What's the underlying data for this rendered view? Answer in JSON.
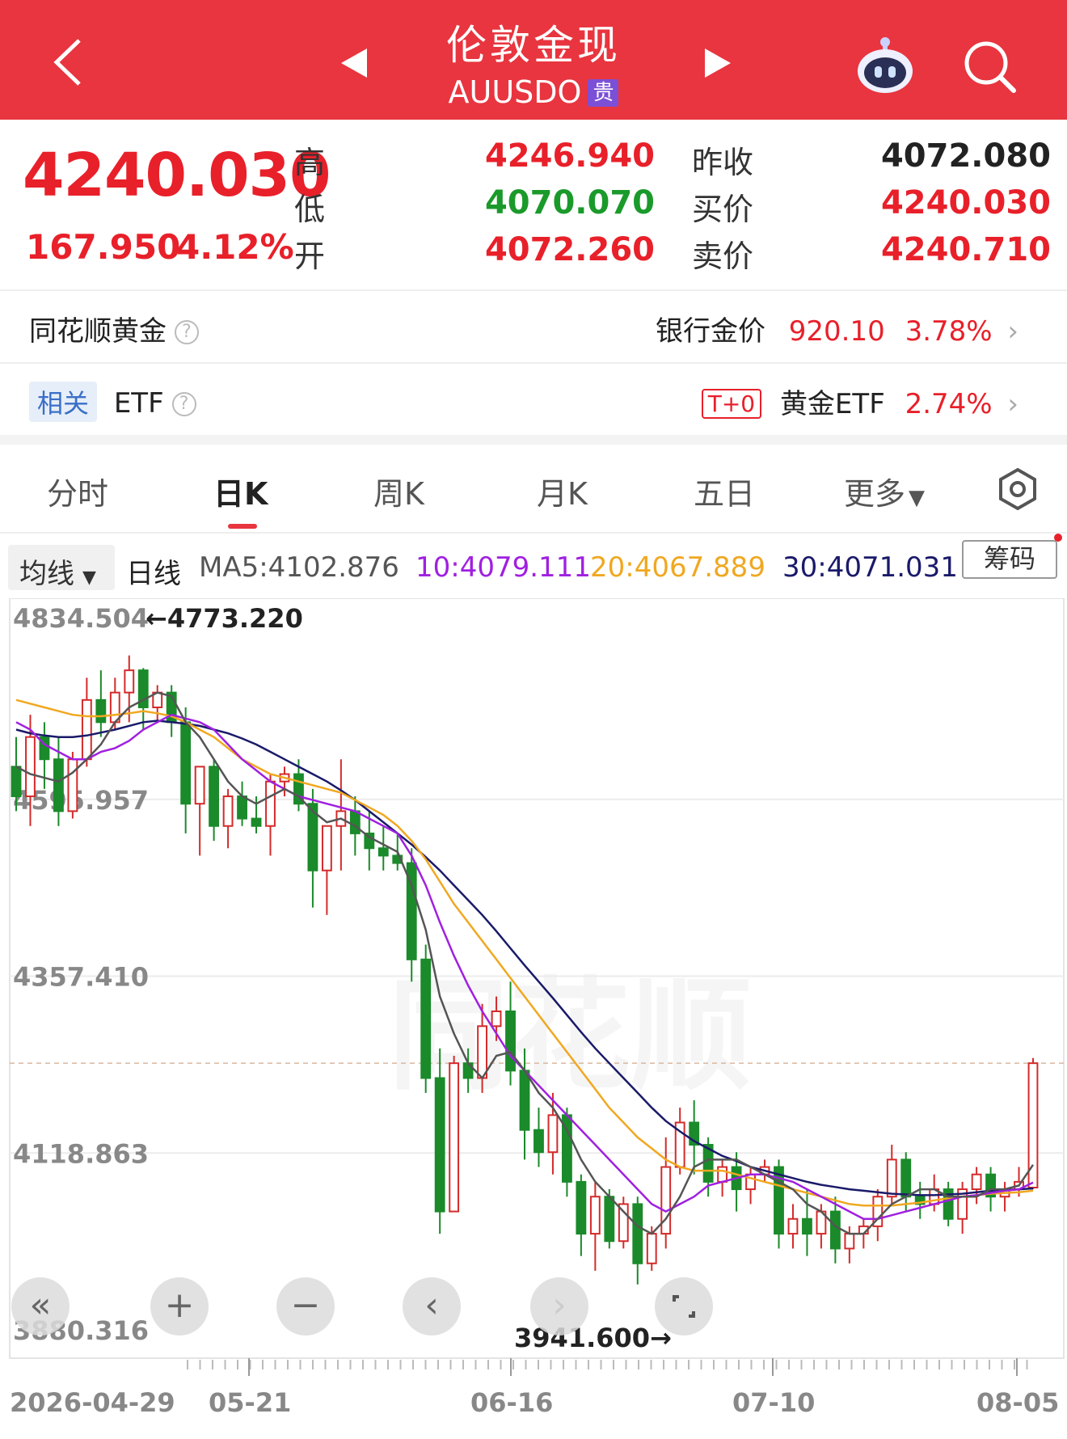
{
  "header": {
    "title": "伦敦金现",
    "code": "AUUSDO",
    "tag": "贵"
  },
  "quote": {
    "price": "4240.030",
    "change": "167.950",
    "change_pct": "4.12%",
    "high_label": "高",
    "low_label": "低",
    "open_label": "开",
    "high": "4246.940",
    "low": "4070.070",
    "open": "4072.260",
    "prev_close_label": "昨收",
    "bid_label": "买价",
    "ask_label": "卖价",
    "prev_close": "4072.080",
    "bid": "4240.030",
    "ask": "4240.710"
  },
  "ths_gold": {
    "label": "同花顺黄金",
    "bank_label": "银行金价",
    "bank_price": "920.10",
    "bank_pct": "3.78%"
  },
  "etf": {
    "tag": "相关",
    "label": "ETF",
    "t0": "T+0",
    "name": "黄金ETF",
    "pct": "2.74%"
  },
  "tabs": [
    "分时",
    "日K",
    "周K",
    "月K",
    "五日",
    "更多"
  ],
  "ma_bar": {
    "select": "均线",
    "period": "日线",
    "ma5": "MA5:4102.876",
    "ma10": "10:4079.111",
    "ma20": "20:4067.889",
    "ma30": "30:4071.031",
    "chip_button": "筹码"
  },
  "colors": {
    "up": "#d42a2a",
    "down": "#1a8a2a",
    "ma5": "#555555",
    "ma10": "#a020e0",
    "ma20": "#f0a820",
    "ma30": "#1a1a6a"
  },
  "chart_data": {
    "type": "candlestick",
    "y_ticks": [
      "4834.504",
      "4595.957",
      "4357.410",
      "4118.863",
      "3880.316"
    ],
    "ylim": [
      3880.316,
      4834.504
    ],
    "x_ticks": [
      "2026-04-29",
      "05-21",
      "06-16",
      "07-10",
      "08-05"
    ],
    "high_marker": "←4773.220",
    "low_marker": "3941.600→",
    "last_price": 4240.03,
    "candles": [
      [
        4640,
        4680,
        4580,
        4600
      ],
      [
        4600,
        4710,
        4560,
        4680
      ],
      [
        4680,
        4700,
        4610,
        4650
      ],
      [
        4650,
        4680,
        4560,
        4580
      ],
      [
        4580,
        4660,
        4570,
        4650
      ],
      [
        4650,
        4760,
        4640,
        4730
      ],
      [
        4730,
        4770,
        4680,
        4700
      ],
      [
        4700,
        4760,
        4690,
        4740
      ],
      [
        4740,
        4790,
        4700,
        4770
      ],
      [
        4770,
        4773,
        4690,
        4720
      ],
      [
        4720,
        4750,
        4700,
        4740
      ],
      [
        4740,
        4750,
        4680,
        4700
      ],
      [
        4700,
        4720,
        4550,
        4590
      ],
      [
        4590,
        4640,
        4520,
        4640
      ],
      [
        4640,
        4650,
        4540,
        4560
      ],
      [
        4560,
        4610,
        4530,
        4600
      ],
      [
        4600,
        4620,
        4560,
        4570
      ],
      [
        4570,
        4600,
        4550,
        4560
      ],
      [
        4560,
        4630,
        4520,
        4620
      ],
      [
        4620,
        4640,
        4600,
        4630
      ],
      [
        4630,
        4650,
        4580,
        4590
      ],
      [
        4590,
        4610,
        4450,
        4500
      ],
      [
        4500,
        4560,
        4440,
        4560
      ],
      [
        4560,
        4650,
        4500,
        4580
      ],
      [
        4580,
        4600,
        4520,
        4550
      ],
      [
        4550,
        4580,
        4500,
        4530
      ],
      [
        4530,
        4560,
        4500,
        4520
      ],
      [
        4520,
        4550,
        4500,
        4510
      ],
      [
        4510,
        4530,
        4350,
        4380
      ],
      [
        4380,
        4400,
        4200,
        4220
      ],
      [
        4220,
        4260,
        4010,
        4040
      ],
      [
        4040,
        4250,
        4040,
        4240
      ],
      [
        4240,
        4260,
        4200,
        4220
      ],
      [
        4220,
        4320,
        4200,
        4290
      ],
      [
        4290,
        4330,
        4270,
        4310
      ],
      [
        4310,
        4350,
        4210,
        4230
      ],
      [
        4230,
        4260,
        4110,
        4150
      ],
      [
        4150,
        4180,
        4100,
        4120
      ],
      [
        4120,
        4200,
        4090,
        4170
      ],
      [
        4170,
        4180,
        4060,
        4080
      ],
      [
        4080,
        4090,
        3980,
        4010
      ],
      [
        4010,
        4080,
        3960,
        4060
      ],
      [
        4060,
        4070,
        3990,
        4000
      ],
      [
        4000,
        4060,
        3990,
        4050
      ],
      [
        4050,
        4060,
        3941.6,
        3970
      ],
      [
        3970,
        4020,
        3960,
        4010
      ],
      [
        4010,
        4140,
        3990,
        4100
      ],
      [
        4100,
        4180,
        4090,
        4160
      ],
      [
        4160,
        4190,
        4090,
        4130
      ],
      [
        4130,
        4140,
        4060,
        4080
      ],
      [
        4080,
        4110,
        4060,
        4100
      ],
      [
        4100,
        4120,
        4040,
        4070
      ],
      [
        4070,
        4100,
        4050,
        4090
      ],
      [
        4090,
        4110,
        4080,
        4100
      ],
      [
        4100,
        4110,
        3990,
        4010
      ],
      [
        4010,
        4050,
        3990,
        4030
      ],
      [
        4030,
        4070,
        3980,
        4010
      ],
      [
        4010,
        4050,
        3990,
        4040
      ],
      [
        4040,
        4060,
        3970,
        3990
      ],
      [
        3990,
        4020,
        3970,
        4010
      ],
      [
        4010,
        4030,
        3990,
        4020
      ],
      [
        4020,
        4070,
        4000,
        4060
      ],
      [
        4060,
        4130,
        4050,
        4110
      ],
      [
        4110,
        4120,
        4040,
        4060
      ],
      [
        4060,
        4080,
        4030,
        4050
      ],
      [
        4050,
        4090,
        4040,
        4070
      ],
      [
        4070,
        4080,
        4020,
        4030
      ],
      [
        4030,
        4080,
        4010,
        4070
      ],
      [
        4070,
        4100,
        4050,
        4090
      ],
      [
        4090,
        4100,
        4040,
        4060
      ],
      [
        4060,
        4080,
        4040,
        4070
      ],
      [
        4070,
        4100,
        4060,
        4080
      ],
      [
        4072.26,
        4246.94,
        4070.07,
        4240.03
      ]
    ],
    "ma5": [
      4640,
      4630,
      4625,
      4620,
      4632,
      4650,
      4670,
      4700,
      4720,
      4730,
      4740,
      4735,
      4700,
      4680,
      4650,
      4620,
      4600,
      4590,
      4600,
      4610,
      4600,
      4580,
      4565,
      4570,
      4560,
      4545,
      4535,
      4525,
      4480,
      4420,
      4330,
      4280,
      4240,
      4220,
      4250,
      4255,
      4230,
      4200,
      4180,
      4150,
      4110,
      4080,
      4060,
      4040,
      4020,
      4010,
      4030,
      4060,
      4100,
      4110,
      4110,
      4110,
      4100,
      4090,
      4080,
      4070,
      4050,
      4040,
      4020,
      4010,
      4010,
      4030,
      4050,
      4060,
      4070,
      4070,
      4060,
      4060,
      4060,
      4070,
      4070,
      4075,
      4103
    ],
    "ma10": [
      4700,
      4690,
      4670,
      4660,
      4650,
      4650,
      4660,
      4665,
      4675,
      4690,
      4700,
      4710,
      4705,
      4700,
      4690,
      4670,
      4650,
      4635,
      4620,
      4610,
      4600,
      4595,
      4590,
      4585,
      4580,
      4570,
      4560,
      4550,
      4520,
      4480,
      4430,
      4385,
      4345,
      4310,
      4280,
      4250,
      4230,
      4210,
      4190,
      4170,
      4150,
      4130,
      4110,
      4090,
      4070,
      4050,
      4040,
      4050,
      4060,
      4075,
      4080,
      4085,
      4090,
      4090,
      4085,
      4080,
      4070,
      4060,
      4050,
      4040,
      4030,
      4030,
      4035,
      4040,
      4045,
      4050,
      4055,
      4060,
      4062,
      4065,
      4068,
      4070,
      4079
    ],
    "ma20": [
      4730,
      4725,
      4720,
      4715,
      4710,
      4708,
      4708,
      4710,
      4712,
      4715,
      4712,
      4708,
      4700,
      4690,
      4680,
      4665,
      4650,
      4640,
      4630,
      4625,
      4620,
      4615,
      4610,
      4605,
      4595,
      4585,
      4575,
      4560,
      4540,
      4515,
      4485,
      4455,
      4430,
      4405,
      4380,
      4355,
      4330,
      4305,
      4280,
      4255,
      4230,
      4205,
      4180,
      4160,
      4140,
      4125,
      4110,
      4100,
      4095,
      4095,
      4095,
      4090,
      4085,
      4080,
      4075,
      4070,
      4065,
      4060,
      4055,
      4050,
      4048,
      4048,
      4048,
      4050,
      4052,
      4055,
      4058,
      4060,
      4062,
      4064,
      4065,
      4066,
      4068
    ],
    "ma30": [
      4690,
      4685,
      4682,
      4680,
      4680,
      4682,
      4686,
      4690,
      4695,
      4700,
      4702,
      4700,
      4698,
      4695,
      4690,
      4685,
      4678,
      4670,
      4660,
      4650,
      4640,
      4630,
      4620,
      4608,
      4595,
      4580,
      4565,
      4550,
      4535,
      4518,
      4500,
      4480,
      4460,
      4440,
      4418,
      4395,
      4372,
      4350,
      4328,
      4305,
      4282,
      4260,
      4240,
      4220,
      4200,
      4180,
      4162,
      4148,
      4135,
      4125,
      4115,
      4108,
      4100,
      4095,
      4090,
      4085,
      4080,
      4076,
      4073,
      4070,
      4068,
      4066,
      4064,
      4063,
      4062,
      4062,
      4063,
      4064,
      4066,
      4068,
      4069,
      4070,
      4071
    ]
  },
  "controls": [
    "«",
    "+",
    "−",
    "‹",
    "›"
  ]
}
